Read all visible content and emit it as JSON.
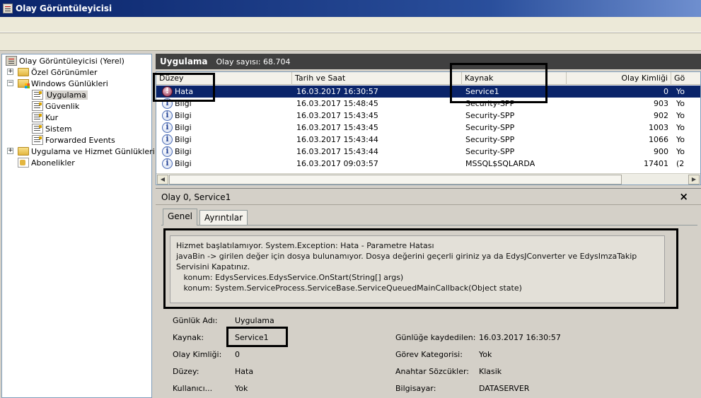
{
  "window": {
    "title": "Olay Görüntüleyicisi"
  },
  "tree": {
    "items": [
      {
        "label": "Olay Görüntüleyicisi (Yerel)",
        "icon": "event-viewer-icon"
      },
      {
        "label": "Özel Görünümler",
        "icon": "folder-icon"
      },
      {
        "label": "Windows Günlükleri",
        "icon": "windows-logs-icon"
      },
      {
        "label": "Uygulama",
        "icon": "log-icon"
      },
      {
        "label": "Güvenlik",
        "icon": "log-icon"
      },
      {
        "label": "Kur",
        "icon": "log-icon"
      },
      {
        "label": "Sistem",
        "icon": "log-icon"
      },
      {
        "label": "Forwarded Events",
        "icon": "log-icon"
      },
      {
        "label": "Uygulama ve Hizmet Günlükleri",
        "icon": "folder-icon"
      },
      {
        "label": "Abonelikler",
        "icon": "subscriptions-icon"
      }
    ]
  },
  "list_header": {
    "title": "Uygulama",
    "count": "Olay sayısı: 68.704"
  },
  "columns": [
    "Düzey",
    "Tarih ve Saat",
    "Kaynak",
    "Olay Kimliği",
    "Gö"
  ],
  "rows": [
    {
      "level": "Hata",
      "datetime": "16.03.2017 16:30:57",
      "source": "Service1",
      "id": "0",
      "cat": "Yo"
    },
    {
      "level": "Bilgi",
      "datetime": "16.03.2017 15:48:45",
      "source": "Security-SPP",
      "id": "903",
      "cat": "Yo"
    },
    {
      "level": "Bilgi",
      "datetime": "16.03.2017 15:43:45",
      "source": "Security-SPP",
      "id": "902",
      "cat": "Yo"
    },
    {
      "level": "Bilgi",
      "datetime": "16.03.2017 15:43:45",
      "source": "Security-SPP",
      "id": "1003",
      "cat": "Yo"
    },
    {
      "level": "Bilgi",
      "datetime": "16.03.2017 15:43:44",
      "source": "Security-SPP",
      "id": "1066",
      "cat": "Yo"
    },
    {
      "level": "Bilgi",
      "datetime": "16.03.2017 15:43:44",
      "source": "Security-SPP",
      "id": "900",
      "cat": "Yo"
    },
    {
      "level": "Bilgi",
      "datetime": "16.03.2017 09:03:57",
      "source": "MSSQL$SQLARDA",
      "id": "17401",
      "cat": "(2"
    }
  ],
  "detail": {
    "title": "Olay 0, Service1",
    "close": "×",
    "tabs": [
      "Genel",
      "Ayrıntılar"
    ],
    "message": [
      "Hizmet başlatılamıyor. System.Exception: Hata - Parametre Hatası",
      "javaBin -> girilen değer için dosya bulunamıyor. Dosya değerini geçerli giriniz ya da EdysJConverter ve EdysImzaTakip Servisini Kapatınız.",
      "",
      "   konum: EdysServices.EdysService.OnStart(String[] args)",
      "   konum: System.ServiceProcess.ServiceBase.ServiceQueuedMainCallback(Object state)"
    ],
    "props": {
      "log_name_label": "Günlük Adı:",
      "log_name": "Uygulama",
      "source_label": "Kaynak:",
      "source": "Service1",
      "logged_label": "Günlüğe kaydedilen:",
      "logged": "16.03.2017 16:30:57",
      "event_id_label": "Olay Kimliği:",
      "event_id": "0",
      "task_label": "Görev Kategorisi:",
      "task": "Yok",
      "level_label": "Düzey:",
      "level": "Hata",
      "keywords_label": "Anahtar Sözcükler:",
      "keywords": "Klasik",
      "user_label": "Kullanıcı...",
      "user": "Yok",
      "computer_label": "Bilgisayar:",
      "computer": "DATASERVER"
    }
  }
}
